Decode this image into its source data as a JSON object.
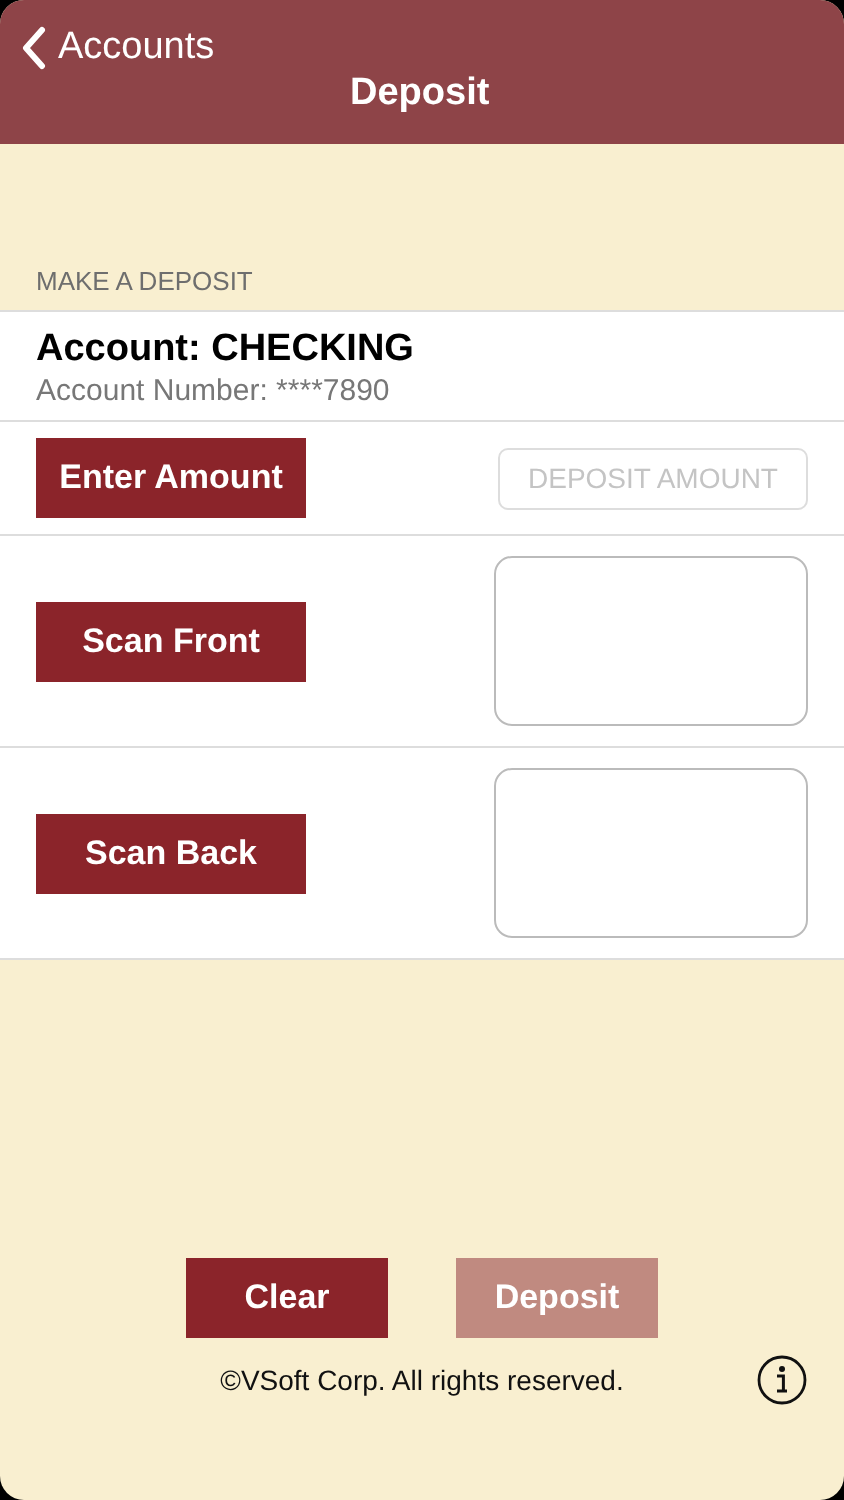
{
  "nav": {
    "back": "Accounts",
    "title": "Deposit"
  },
  "section": "MAKE A DEPOSIT",
  "account": {
    "name": "Account: CHECKING",
    "number": "Account Number: ****7890"
  },
  "rows": [
    {
      "kind": "amount",
      "button": "Enter Amount",
      "placeholder": "DEPOSIT AMOUNT"
    },
    {
      "kind": "scan",
      "button": "Scan Front"
    },
    {
      "kind": "scan",
      "button": "Scan Back"
    }
  ],
  "actions": [
    {
      "label": "Clear",
      "disabled": false
    },
    {
      "label": "Deposit",
      "disabled": true
    }
  ],
  "footer": "©VSoft Corp. All rights reserved."
}
